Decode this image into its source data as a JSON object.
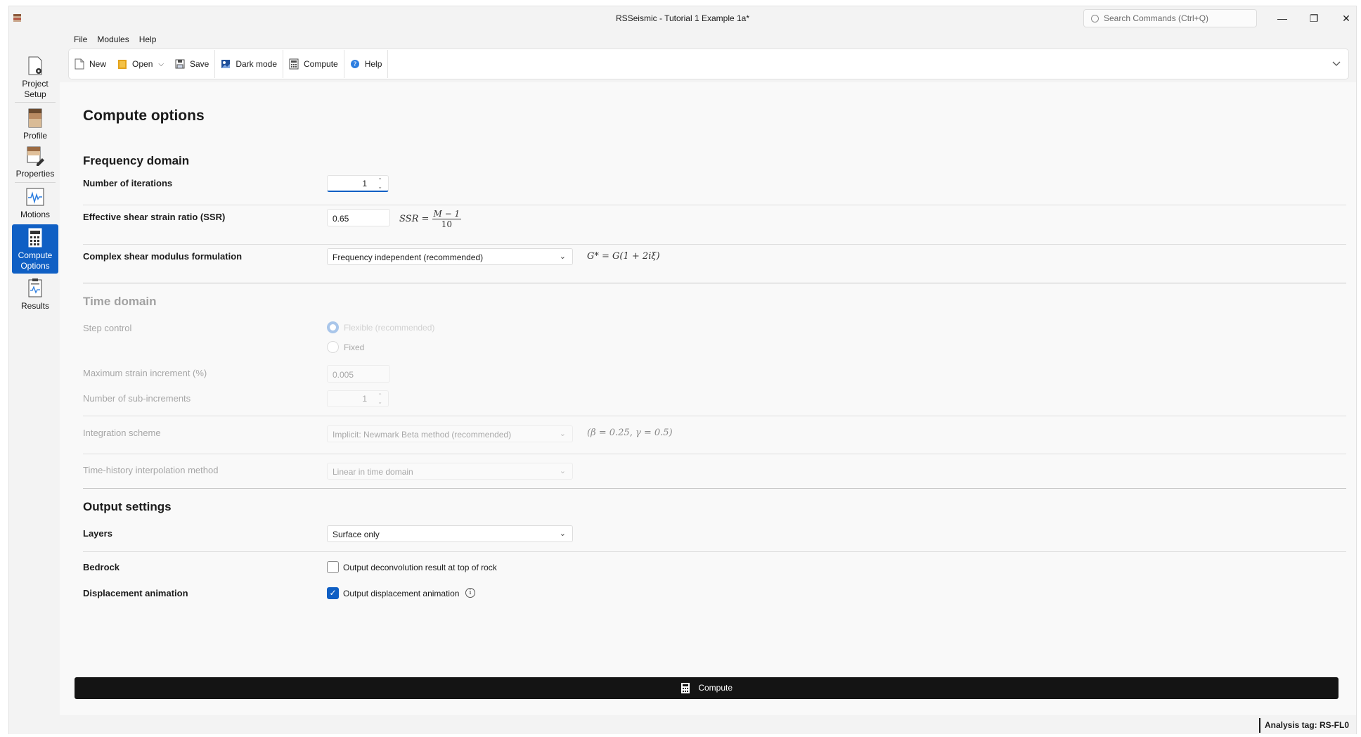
{
  "window": {
    "title": "RSSeismic - Tutorial 1 Example 1a*",
    "search_placeholder": "Search Commands (Ctrl+Q)",
    "minimize_icon": "minimize-icon",
    "maximize_icon": "restore-icon",
    "close_icon": "close-icon"
  },
  "menu": [
    "File",
    "Modules",
    "Help"
  ],
  "toolbar": {
    "new": "New",
    "open": "Open",
    "save": "Save",
    "dark_mode": "Dark mode",
    "compute": "Compute",
    "help": "Help"
  },
  "sidebar": {
    "items": [
      {
        "line1": "Project",
        "line2": "Setup"
      },
      {
        "line1": "Profile",
        "line2": ""
      },
      {
        "line1": "Properties",
        "line2": ""
      },
      {
        "line1": "Motions",
        "line2": ""
      },
      {
        "line1": "Compute",
        "line2": "Options"
      },
      {
        "line1": "Results",
        "line2": ""
      }
    ],
    "active_index": 4
  },
  "page": {
    "title": "Compute options",
    "frequency": {
      "heading": "Frequency domain",
      "iterations_label": "Number of iterations",
      "iterations_value": "1",
      "ssr_label": "Effective shear strain ratio (SSR)",
      "ssr_value": "0.65",
      "ssr_formula_lhs": "SSR =",
      "ssr_formula_num": "M − 1",
      "ssr_formula_den": "10",
      "complex_label": "Complex shear modulus formulation",
      "complex_value": "Frequency independent (recommended)",
      "complex_formula": "G* = G(1 + 2iξ)"
    },
    "time": {
      "heading": "Time domain",
      "step_label": "Step control",
      "step_option1": "Flexible (recommended)",
      "step_option2": "Fixed",
      "max_strain_label": "Maximum strain increment (%)",
      "max_strain_value": "0.005",
      "sub_inc_label": "Number of sub-increments",
      "sub_inc_value": "1",
      "integration_label": "Integration scheme",
      "integration_value": "Implicit: Newmark Beta method (recommended)",
      "integration_formula": "(β = 0.25, γ = 0.5)",
      "interp_label": "Time-history interpolation method",
      "interp_value": "Linear in time domain"
    },
    "output": {
      "heading": "Output settings",
      "layers_label": "Layers",
      "layers_value": "Surface only",
      "bedrock_label": "Bedrock",
      "bedrock_option": "Output deconvolution result at top of rock",
      "bedrock_checked": false,
      "anim_label": "Displacement animation",
      "anim_option": "Output displacement animation",
      "anim_checked": true
    },
    "compute_button": "Compute"
  },
  "status": {
    "analysis_tag": "Analysis tag: RS-FL0"
  },
  "colors": {
    "accent": "#0f5fc4",
    "compute_bar": "#141414"
  }
}
